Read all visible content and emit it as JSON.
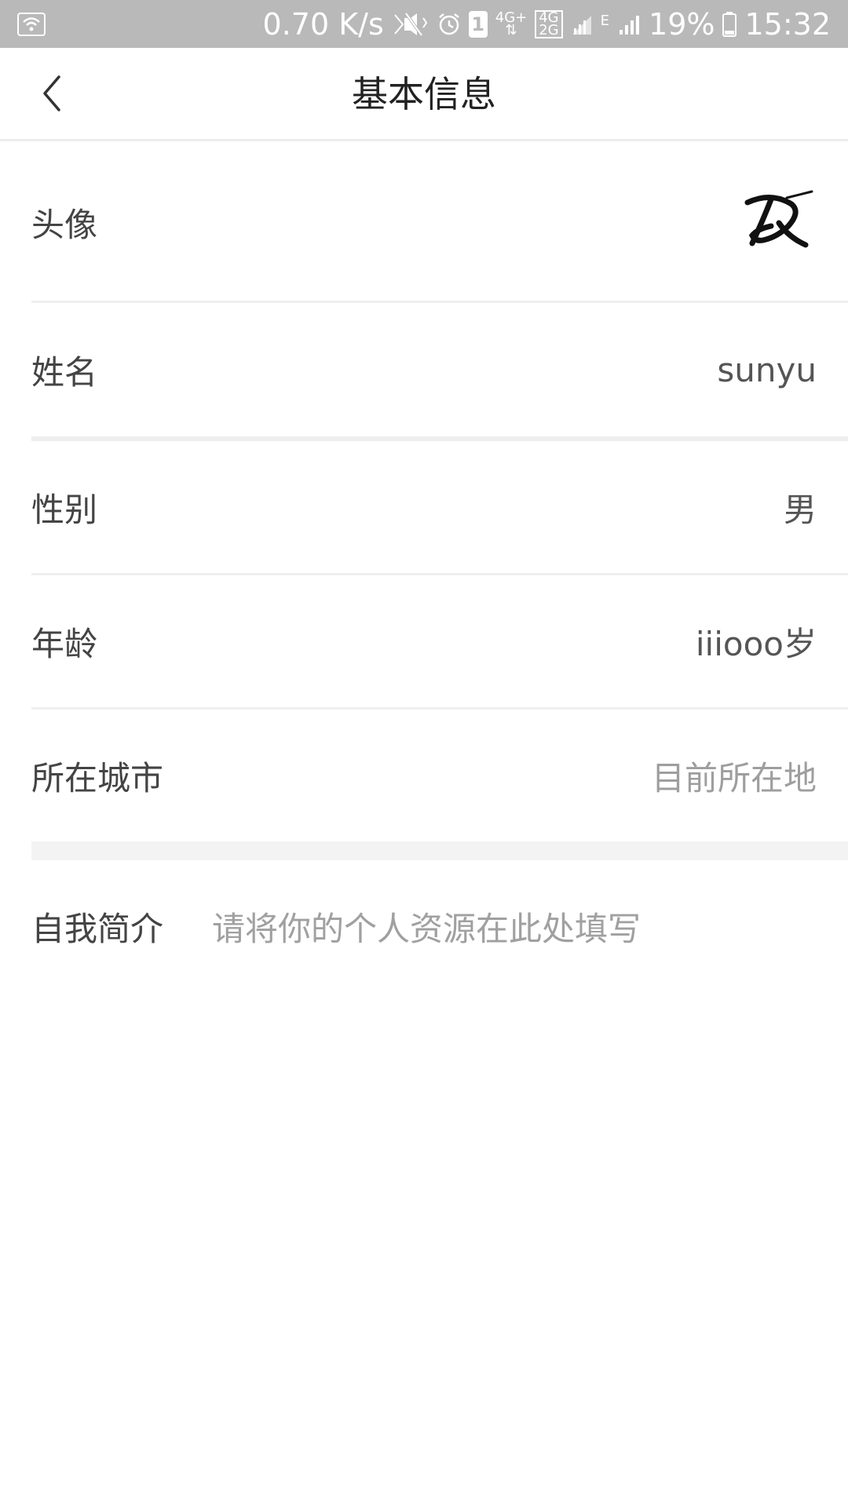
{
  "status_bar": {
    "speed": "0.70 K/s",
    "sim_badge": "1",
    "net_4g_plus": "4G+",
    "net_4g": "4G",
    "net_2g": "2G",
    "net_e": "E",
    "battery": "19%",
    "time": "15:32",
    "icons": [
      "wifi-icon",
      "mute-icon",
      "alarm-icon",
      "sim-icon",
      "signal-icon",
      "battery-icon"
    ]
  },
  "header": {
    "title": "基本信息",
    "back_icon": "chevron-left-icon"
  },
  "rows": {
    "avatar": {
      "label": "头像",
      "icon": "avatar-signature"
    },
    "name": {
      "label": "姓名",
      "value": "sunyu"
    },
    "gender": {
      "label": "性别",
      "value": "男"
    },
    "age": {
      "label": "年龄",
      "value": "iiiooo岁"
    },
    "city": {
      "label": "所在城市",
      "placeholder": "目前所在地"
    }
  },
  "bio": {
    "label": "自我简介",
    "placeholder": "请将你的个人资源在此处填写"
  },
  "colors": {
    "status_bar_bg": "#b9b9b9",
    "divider": "#efefef",
    "placeholder_text": "#9e9e9e"
  }
}
